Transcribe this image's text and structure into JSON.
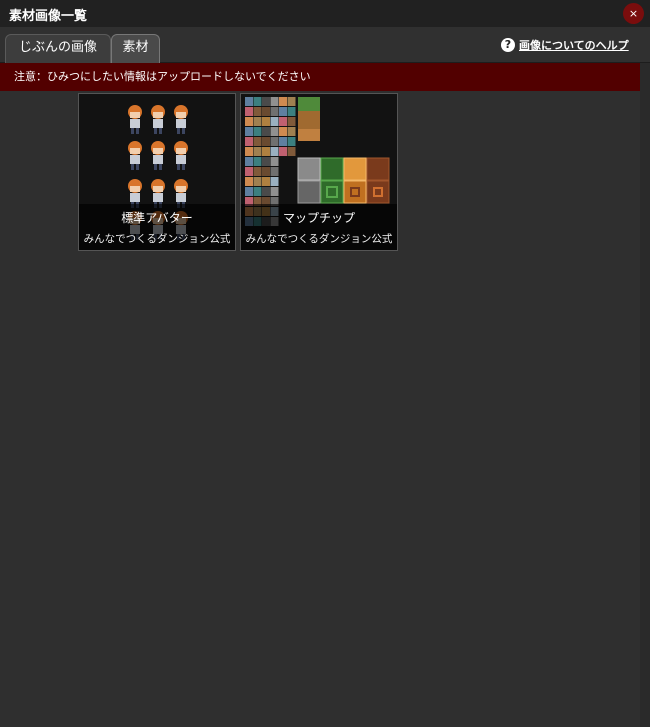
{
  "window": {
    "title": "素材画像一覧",
    "close_label": "×"
  },
  "tabs": [
    {
      "label": "じぶんの画像",
      "active": false
    },
    {
      "label": "素材",
      "active": true
    }
  ],
  "help": {
    "icon": "?",
    "label": "画像についてのヘルプ"
  },
  "warning": {
    "text": "注意：ひみつにしたい情報はアップロードしないでください"
  },
  "assets": [
    {
      "name": "標準アバター",
      "author": "みんなでつくるダンジョン公式"
    },
    {
      "name": "マップチップ",
      "author": "みんなでつくるダンジョン公式"
    }
  ],
  "colors": {
    "title_bar": "#212121",
    "background": "#2f2f2f",
    "warning_bg": "#520000",
    "close_button": "#7a0d0d"
  }
}
